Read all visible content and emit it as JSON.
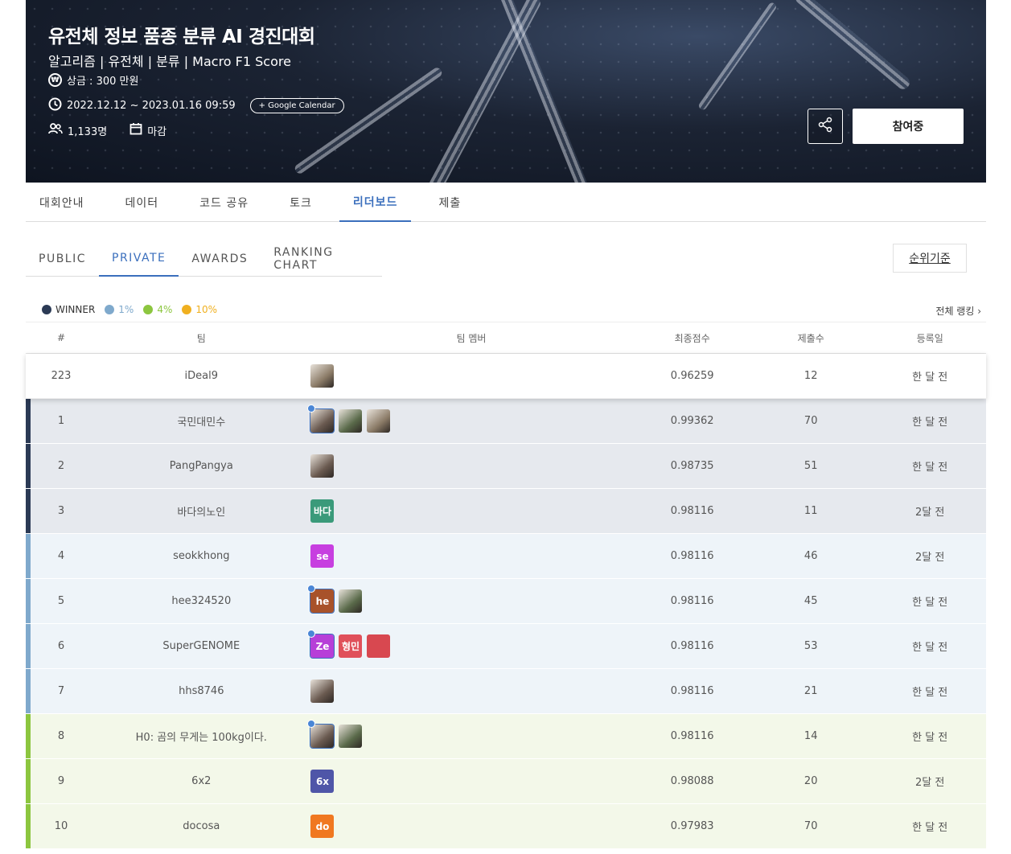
{
  "hero": {
    "title": "유전체 정보 품종 분류 AI 경진대회",
    "subtitle": "알고리즘 | 유전체 | 분류 | Macro F1 Score",
    "prize_icon": "won-icon",
    "prize": "상금 : 300 만원",
    "date_icon": "clock-icon",
    "date_range": "2022.12.12 ~ 2023.01.16 09:59",
    "calendar_button": "+ Google Calendar",
    "participants_icon": "people-icon",
    "participants": "1,133명",
    "status_icon": "calendar-icon",
    "status": "마감",
    "share_icon": "share-icon",
    "join_button": "참여중"
  },
  "main_tabs": [
    {
      "label": "대회안내",
      "active": false
    },
    {
      "label": "데이터",
      "active": false
    },
    {
      "label": "코드 공유",
      "active": false
    },
    {
      "label": "토크",
      "active": false
    },
    {
      "label": "리더보드",
      "active": true
    },
    {
      "label": "제출",
      "active": false
    }
  ],
  "sub_tabs": [
    {
      "label": "PUBLIC",
      "active": false
    },
    {
      "label": "PRIVATE",
      "active": true
    },
    {
      "label": "AWARDS",
      "active": false
    },
    {
      "label": "RANKING CHART",
      "active": false
    }
  ],
  "rank_basis_button": "순위기준",
  "legend": [
    {
      "label": "WINNER",
      "color": "#2b3a55"
    },
    {
      "label": "1%",
      "color": "#7fa9cc"
    },
    {
      "label": "4%",
      "color": "#8cc63f"
    },
    {
      "label": "10%",
      "color": "#f0b020"
    }
  ],
  "all_ranking_link": "전체 랭킹 ›",
  "table": {
    "headers": {
      "rank": "#",
      "team": "팀",
      "members": "팀 멤버",
      "score": "최종점수",
      "submissions": "제출수",
      "date": "등록일"
    },
    "my_row": {
      "rank": "223",
      "team": "iDeal9",
      "score": "0.96259",
      "submissions": "12",
      "date": "한 달 전",
      "members": [
        {
          "type": "photo",
          "text": "",
          "color": "#c8b8a8",
          "leader": false
        }
      ]
    },
    "rows": [
      {
        "rank": "1",
        "team": "국민대민수",
        "score": "0.99362",
        "submissions": "70",
        "date": "한 달 전",
        "tier": "winner",
        "members": [
          {
            "type": "photo",
            "text": "",
            "leader": true
          },
          {
            "type": "photo",
            "text": "",
            "leader": false
          },
          {
            "type": "photo",
            "text": "",
            "leader": false
          }
        ]
      },
      {
        "rank": "2",
        "team": "PangPangya",
        "score": "0.98735",
        "submissions": "51",
        "date": "한 달 전",
        "tier": "winner",
        "members": [
          {
            "type": "photo",
            "text": "",
            "leader": false
          }
        ]
      },
      {
        "rank": "3",
        "team": "바다의노인",
        "score": "0.98116",
        "submissions": "11",
        "date": "2달 전",
        "tier": "winner",
        "members": [
          {
            "type": "text",
            "text": "바다",
            "color": "#3a9a7a",
            "leader": false
          }
        ]
      },
      {
        "rank": "4",
        "team": "seokkhong",
        "score": "0.98116",
        "submissions": "46",
        "date": "2달 전",
        "tier": "p1",
        "members": [
          {
            "type": "text",
            "text": "se",
            "color": "#c73fe0",
            "leader": false
          }
        ]
      },
      {
        "rank": "5",
        "team": "hee324520",
        "score": "0.98116",
        "submissions": "45",
        "date": "한 달 전",
        "tier": "p1",
        "members": [
          {
            "type": "text",
            "text": "he",
            "color": "#a8522a",
            "leader": true
          },
          {
            "type": "photo",
            "text": "",
            "leader": false
          }
        ]
      },
      {
        "rank": "6",
        "team": "SuperGENOME",
        "score": "0.98116",
        "submissions": "53",
        "date": "한 달 전",
        "tier": "p1",
        "members": [
          {
            "type": "text",
            "text": "Ze",
            "color": "#b73fd8",
            "leader": true
          },
          {
            "type": "text",
            "text": "형민",
            "color": "#e0505a",
            "leader": false
          },
          {
            "type": "text",
            "text": "",
            "color": "#d84850",
            "leader": false
          }
        ]
      },
      {
        "rank": "7",
        "team": "hhs8746",
        "score": "0.98116",
        "submissions": "21",
        "date": "한 달 전",
        "tier": "p1",
        "members": [
          {
            "type": "photo",
            "text": "",
            "leader": false
          }
        ]
      },
      {
        "rank": "8",
        "team": "H0: 곰의 무게는 100kg이다.",
        "score": "0.98116",
        "submissions": "14",
        "date": "한 달 전",
        "tier": "p4",
        "members": [
          {
            "type": "photo",
            "text": "",
            "leader": true
          },
          {
            "type": "photo",
            "text": "",
            "leader": false
          }
        ]
      },
      {
        "rank": "9",
        "team": "6x2",
        "score": "0.98088",
        "submissions": "20",
        "date": "2달 전",
        "tier": "p4",
        "members": [
          {
            "type": "text",
            "text": "6x",
            "color": "#4f56a8",
            "leader": false
          }
        ]
      },
      {
        "rank": "10",
        "team": "docosa",
        "score": "0.97983",
        "submissions": "70",
        "date": "한 달 전",
        "tier": "p4",
        "members": [
          {
            "type": "text",
            "text": "do",
            "color": "#f07820",
            "leader": false
          }
        ]
      }
    ]
  },
  "tier_styles": {
    "winner": {
      "bar": "#2b3a55",
      "bg": "#e6e9ee"
    },
    "p1": {
      "bar": "#7fa9cc",
      "bg": "#eef4f9"
    },
    "p4": {
      "bar": "#8cc63f",
      "bg": "#f3f8e9"
    }
  }
}
